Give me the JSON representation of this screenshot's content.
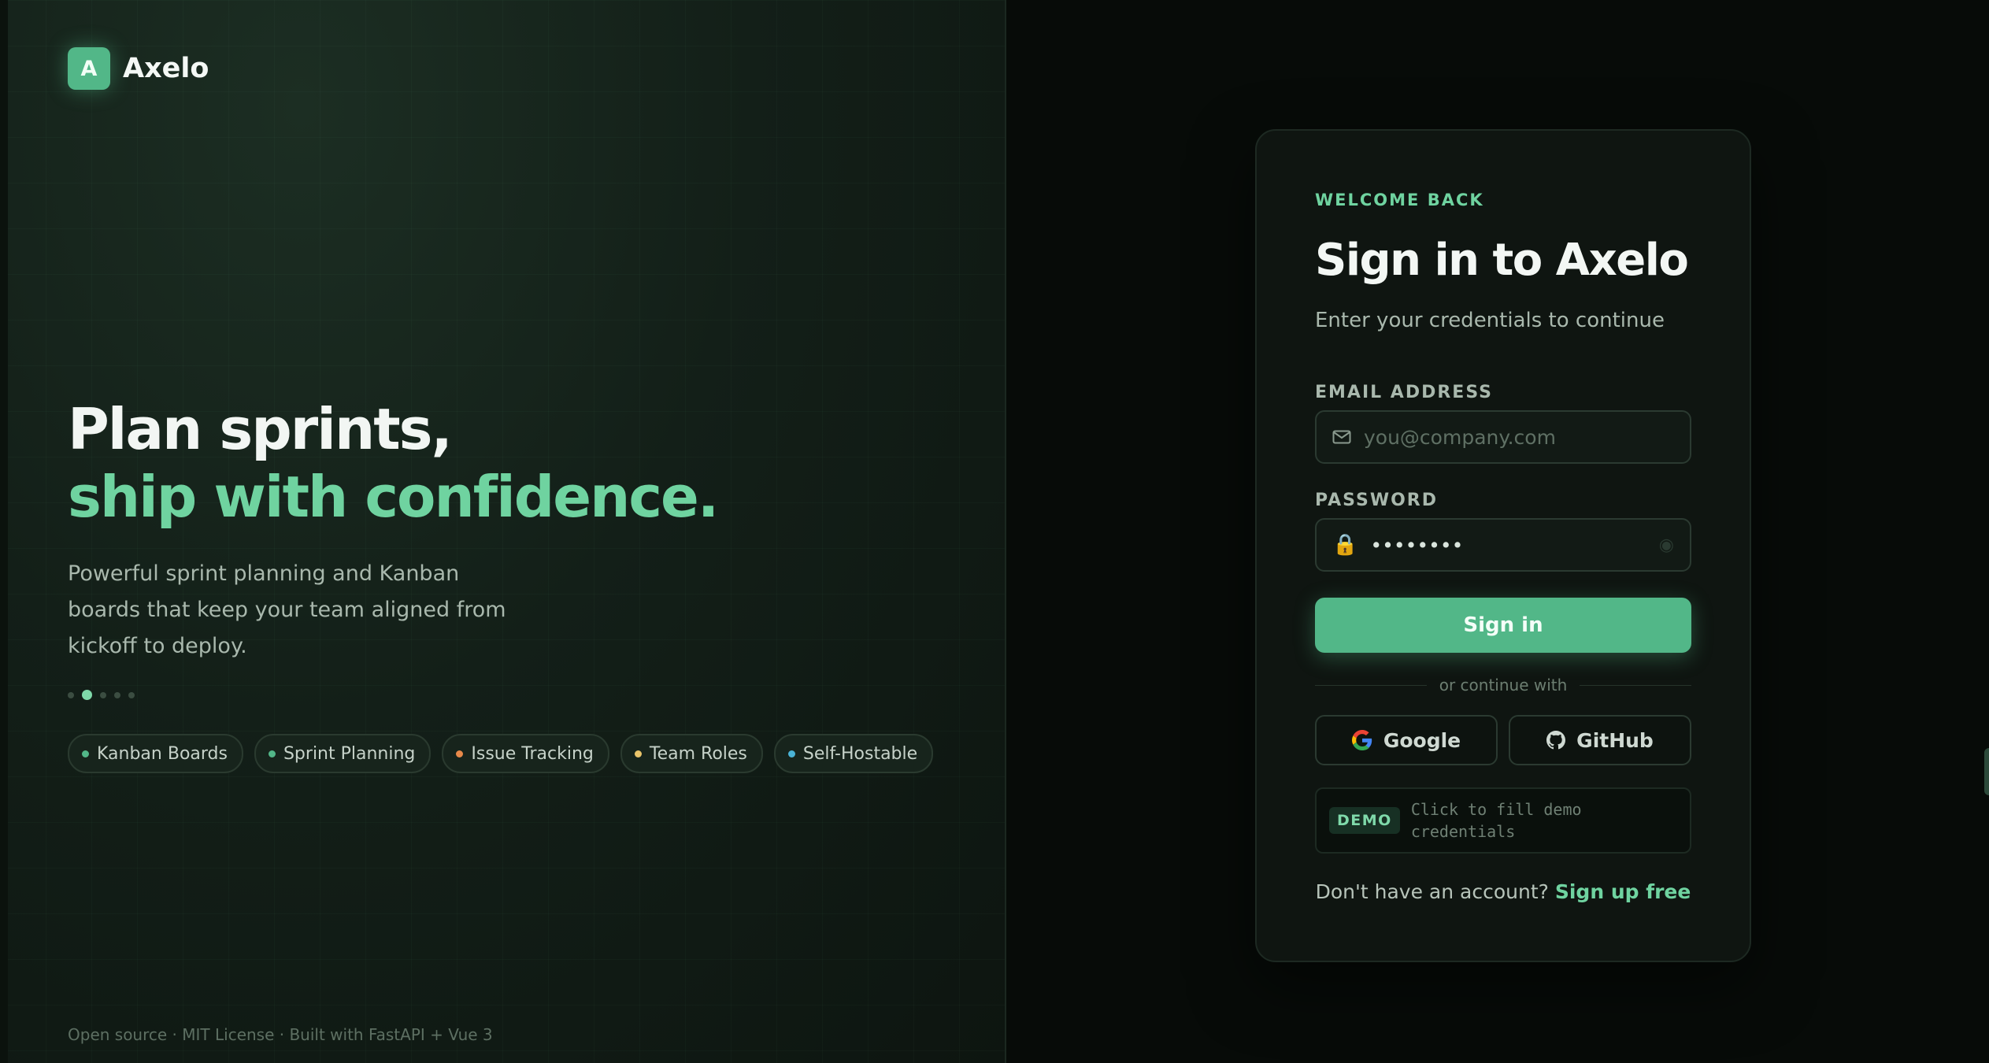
{
  "brand": {
    "logo_letter": "A",
    "name": "Axelo",
    "accent": "#52b788"
  },
  "hero": {
    "headline_line1": "Plan sprints,",
    "headline_line2": "ship with confidence.",
    "description": "Powerful sprint planning and Kanban boards that keep your team aligned from kickoff to deploy.",
    "carousel": {
      "count": 5,
      "active_index": 1
    },
    "tags": [
      {
        "label": "Kanban Boards",
        "color": "#52b788"
      },
      {
        "label": "Sprint Planning",
        "color": "#52b788"
      },
      {
        "label": "Issue Tracking",
        "color": "#e8894a"
      },
      {
        "label": "Team Roles",
        "color": "#e9c46a"
      },
      {
        "label": "Self-Hostable",
        "color": "#4ab3d6"
      }
    ],
    "footer": "Open source · MIT License · Built with FastAPI + Vue 3"
  },
  "login": {
    "eyebrow": "WELCOME BACK",
    "title": "Sign in to Axelo",
    "subtitle": "Enter your credentials to continue",
    "email": {
      "label": "EMAIL ADDRESS",
      "placeholder": "you@company.com",
      "value": ""
    },
    "password": {
      "label": "PASSWORD",
      "value": "password"
    },
    "submit_label": "Sign in",
    "divider_text": "or continue with",
    "social": {
      "google_label": "Google",
      "github_label": "GitHub"
    },
    "demo": {
      "badge": "DEMO",
      "text": "Click to fill demo credentials"
    },
    "signup": {
      "prompt": "Don't have an account?",
      "link": "Sign up free"
    }
  }
}
